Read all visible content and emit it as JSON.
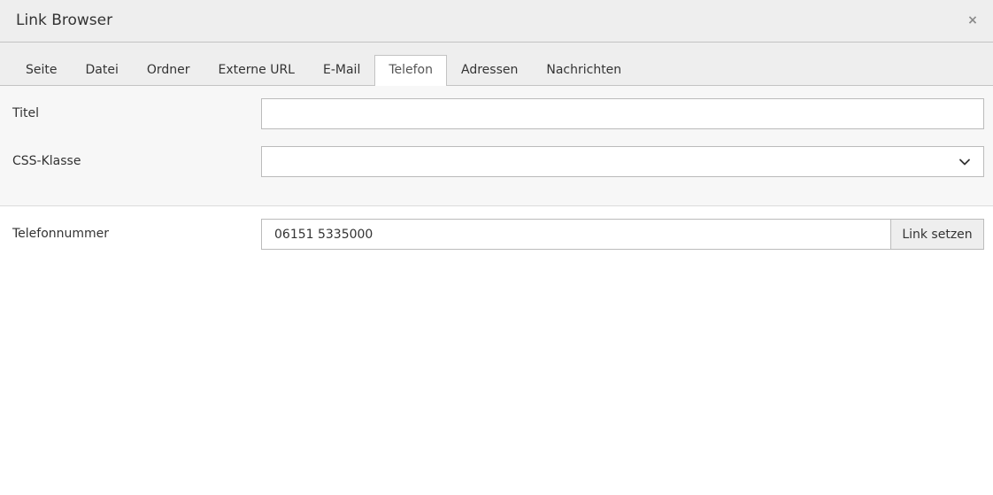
{
  "header": {
    "title": "Link Browser",
    "close_label": "×"
  },
  "tabs": [
    {
      "label": "Seite"
    },
    {
      "label": "Datei"
    },
    {
      "label": "Ordner"
    },
    {
      "label": "Externe URL"
    },
    {
      "label": "E-Mail"
    },
    {
      "label": "Telefon",
      "active": true
    },
    {
      "label": "Adressen"
    },
    {
      "label": "Nachrichten"
    }
  ],
  "form": {
    "title_label": "Titel",
    "title_value": "",
    "css_class_label": "CSS-Klasse",
    "css_class_value": ""
  },
  "phone": {
    "label": "Telefonnummer",
    "value": "06151 5335000",
    "submit_label": "Link setzen"
  },
  "colors": {
    "header_bg": "#eeeeee",
    "form_bg": "#f7f7f7",
    "border": "#bbbbbb"
  },
  "icons": {
    "close": "close-icon",
    "select": "chevron-down-icon"
  }
}
